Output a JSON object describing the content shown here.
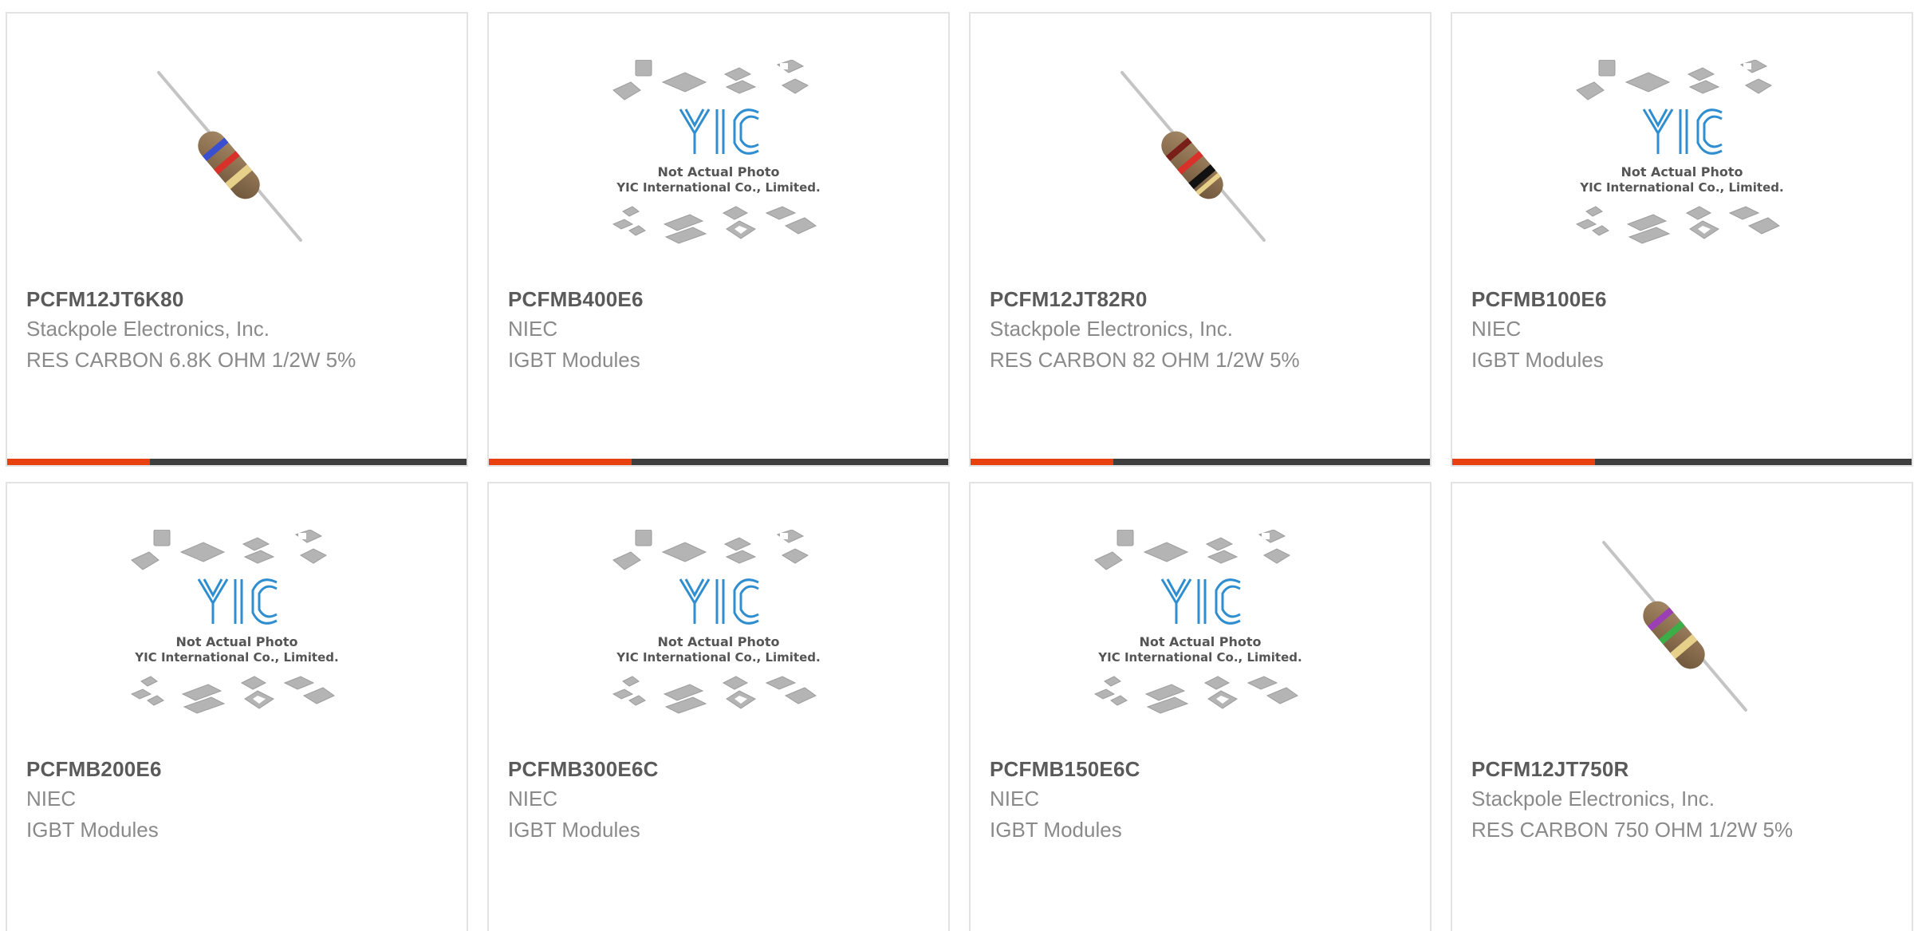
{
  "accent_color": "#e9400f",
  "bar_track_color": "#3e3e3e",
  "placeholder": {
    "line1": "Not Actual Photo",
    "line2": "YIC International Co., Limited."
  },
  "products": [
    {
      "part_number": "PCFM12JT6K80",
      "manufacturer": "Stackpole Electronics, Inc.",
      "description": "RES CARBON 6.8K OHM 1/2W 5%",
      "image": "resistor-image",
      "band_colors": [
        "#3a4fd0",
        "#d8312a",
        "#e6d08a"
      ],
      "progress": 0.31
    },
    {
      "part_number": "PCFMB400E6",
      "manufacturer": "NIEC",
      "description": "IGBT Modules",
      "image": "not-actual-photo",
      "progress": 0.31
    },
    {
      "part_number": "PCFM12JT82R0",
      "manufacturer": "Stackpole Electronics, Inc.",
      "description": "RES CARBON 82 OHM 1/2W 5%",
      "image": "resistor-image",
      "band_colors": [
        "#7a1e1a",
        "#d8312a",
        "#111111"
      ],
      "progress": 0.31
    },
    {
      "part_number": "PCFMB100E6",
      "manufacturer": "NIEC",
      "description": "IGBT Modules",
      "image": "not-actual-photo",
      "progress": 0.31
    },
    {
      "part_number": "PCFMB200E6",
      "manufacturer": "NIEC",
      "description": "IGBT Modules",
      "image": "not-actual-photo"
    },
    {
      "part_number": "PCFMB300E6C",
      "manufacturer": "NIEC",
      "description": "IGBT Modules",
      "image": "not-actual-photo"
    },
    {
      "part_number": "PCFMB150E6C",
      "manufacturer": "NIEC",
      "description": "IGBT Modules",
      "image": "not-actual-photo"
    },
    {
      "part_number": "PCFM12JT750R",
      "manufacturer": "Stackpole Electronics, Inc.",
      "description": "RES CARBON 750 OHM 1/2W 5%",
      "image": "resistor-image",
      "band_colors": [
        "#9b3fb6",
        "#3cae48",
        "#e6d08a"
      ]
    }
  ]
}
